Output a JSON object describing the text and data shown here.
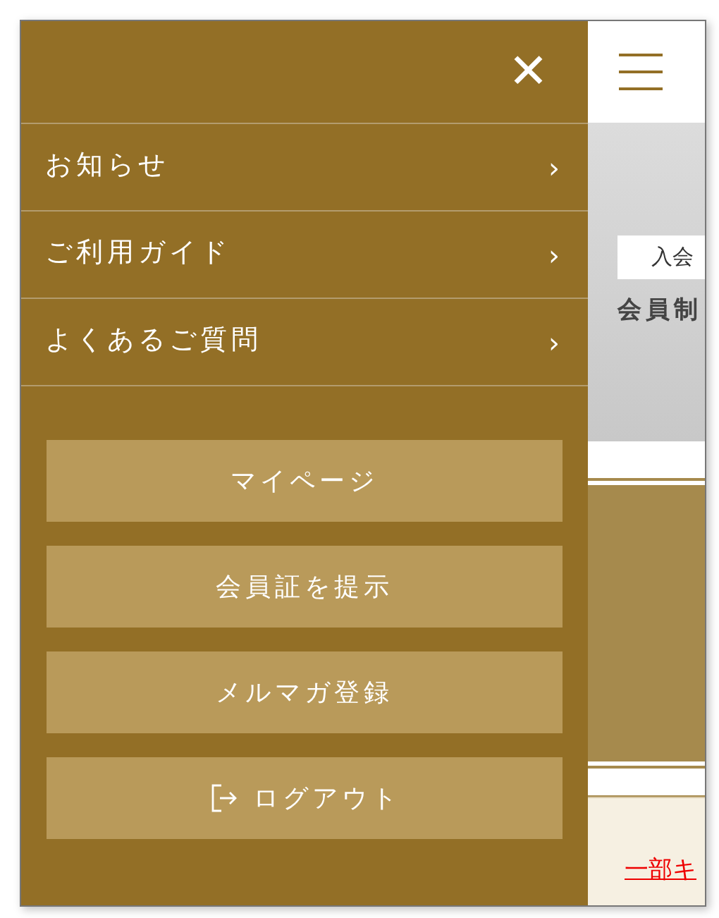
{
  "menu": {
    "close": "✕",
    "items": [
      {
        "label": "お知らせ",
        "chevron": "›"
      },
      {
        "label": "ご利用ガイド",
        "chevron": "›"
      },
      {
        "label": "よくあるご質問",
        "chevron": "›"
      }
    ],
    "buttons": [
      {
        "label": "マイページ",
        "kind": "plain"
      },
      {
        "label": "会員証を提示",
        "kind": "plain"
      },
      {
        "label": "メルマガ登録",
        "kind": "plain"
      },
      {
        "label": "ログアウト",
        "kind": "logout"
      }
    ]
  },
  "page": {
    "hero_tag": "入会",
    "hero_title": "会員制",
    "link": "一部キ"
  }
}
